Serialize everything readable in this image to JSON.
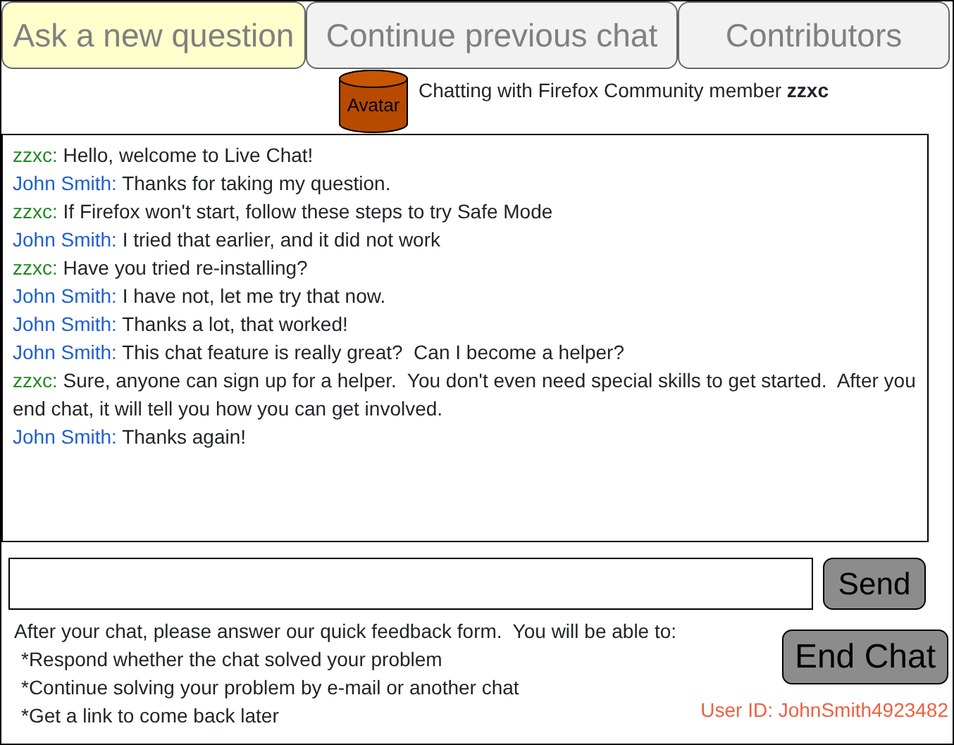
{
  "tabs": [
    {
      "label": "Ask a new question",
      "selected": true
    },
    {
      "label": "Continue previous chat",
      "selected": false
    },
    {
      "label": "Contributors",
      "selected": false
    }
  ],
  "avatar": {
    "label": "Avatar"
  },
  "chat_header": "Chatting with Firefox Community member **zzxc**",
  "messages": [
    {
      "sender": "zzxc:",
      "kind": "helper",
      "text": "Hello, welcome to Live Chat!"
    },
    {
      "sender": "John Smith:",
      "kind": "user",
      "text": "Thanks for taking my question."
    },
    {
      "sender": "zzxc:",
      "kind": "helper",
      "text": "If Firefox won't start, follow these steps to try Safe Mode"
    },
    {
      "sender": "John Smith:",
      "kind": "user",
      "text": "I tried that earlier, and it did not work"
    },
    {
      "sender": "zzxc:",
      "kind": "helper",
      "text": "Have you tried re-installing?"
    },
    {
      "sender": "John Smith:",
      "kind": "user",
      "text": "I have not, let me try that now."
    },
    {
      "sender": "John Smith:",
      "kind": "user",
      "text": "Thanks a lot, that worked!"
    },
    {
      "sender": "John Smith:",
      "kind": "user",
      "text": "This chat feature is really great?  Can I become a helper?"
    },
    {
      "sender": "zzxc:",
      "kind": "helper",
      "text": "Sure, anyone can sign up for a helper.  You don't even need special skills to get started.  After you end chat, it will tell you how you can get involved."
    },
    {
      "sender": "John Smith:",
      "kind": "user",
      "text": "Thanks again!"
    }
  ],
  "send_button": "Send",
  "feedback": {
    "intro": "After your chat, please answer our quick feedback form.  You will be able to:",
    "items": [
      "*Respond whether the chat solved your problem",
      "*Continue solving your problem by e-mail or another chat",
      "*Get a link to come back later"
    ]
  },
  "end_chat_button": "End Chat",
  "user_id": "User ID: JohnSmith4923482"
}
